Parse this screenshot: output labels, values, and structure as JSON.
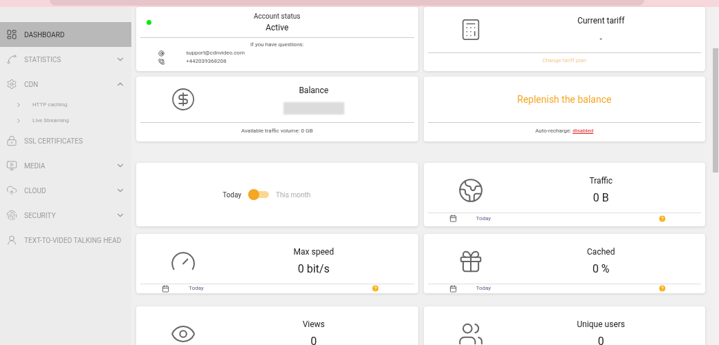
{
  "sidebar": {
    "items": [
      {
        "label": "DASHBOARD",
        "selected": true
      },
      {
        "label": "STATISTICS",
        "selected": false,
        "expanded": false
      },
      {
        "label": "CDN",
        "selected": false,
        "expanded": true,
        "children": [
          {
            "label": "HTTP caching",
            "selected": false
          },
          {
            "label": "Live Streaming",
            "selected": false
          }
        ]
      },
      {
        "label": "SSL CERTIFICATES",
        "selected": false
      },
      {
        "label": "MEDIA",
        "selected": false,
        "expanded": false
      },
      {
        "label": "CLOUD",
        "selected": false,
        "expanded": false
      },
      {
        "label": "SECURITY",
        "selected": false,
        "expanded": false
      },
      {
        "label": "TEXT-TO-VIDEO TALKING HEAD",
        "selected": false
      }
    ]
  },
  "account": {
    "title": "Account status",
    "status": "Active",
    "active": true,
    "questions": "If you have questions:",
    "email": "support@cdnvideo.com",
    "phone": "+442039368208"
  },
  "tariff": {
    "title": "Current tariff",
    "value": "-",
    "link": "Change tariff plan"
  },
  "balance": {
    "title": "Balance",
    "footer": "Available traffic volume: 0 GB"
  },
  "replenish": {
    "button": "Replenish the balance",
    "auto_label": "Auto-recharge:",
    "auto_value": "disabled"
  },
  "period_toggle": {
    "options": [
      {
        "label": "Today",
        "selected": true
      },
      {
        "label": "This month",
        "selected": false
      }
    ]
  },
  "stats": [
    {
      "title": "Traffic",
      "value": "0 B",
      "period": "Today"
    },
    {
      "title": "Max speed",
      "value": "0 bit/s",
      "period": "Today"
    },
    {
      "title": "Cached",
      "value": "0 %",
      "period": "Today"
    },
    {
      "title": "Views",
      "value": "0"
    },
    {
      "title": "Unique users",
      "value": "0"
    }
  ]
}
